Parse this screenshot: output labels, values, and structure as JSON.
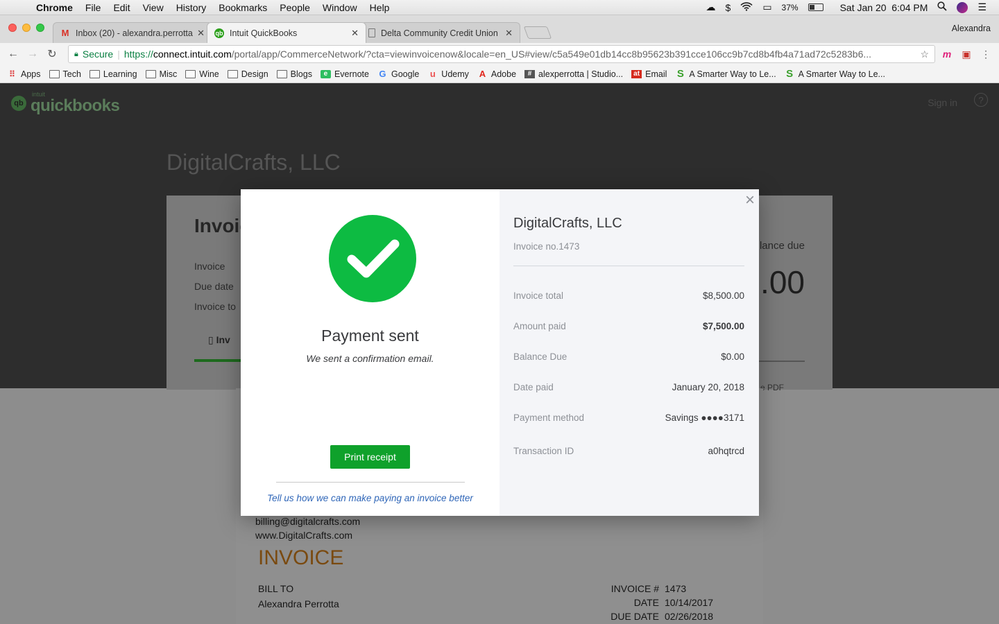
{
  "menubar": {
    "app": "Chrome",
    "items": [
      "File",
      "Edit",
      "View",
      "History",
      "Bookmarks",
      "People",
      "Window",
      "Help"
    ],
    "battery": "37%",
    "datetime": "Sat Jan 20  6:04 PM"
  },
  "tabs": [
    {
      "title": "Inbox (20) - alexandra.perrotta",
      "favicon": "M",
      "color": "#d93025"
    },
    {
      "title": "Intuit QuickBooks",
      "favicon": "qb",
      "color": "#2ca01c"
    },
    {
      "title": "Delta Community Credit Union",
      "favicon": "doc",
      "color": "#555555"
    }
  ],
  "profile": "Alexandra",
  "address": {
    "secure": "Secure",
    "https": "https://",
    "host": "connect.intuit.com",
    "path": "/portal/app/CommerceNetwork/?cta=viewinvoicenow&locale=en_US#view/c5a549e01db14cc8b95623b391cce106cc9b7cd8b4fb4a71ad72c5283b6..."
  },
  "bookmarks": [
    {
      "label": "Apps",
      "icon": "apps-icon"
    },
    {
      "label": "Tech",
      "icon": "folder-icon"
    },
    {
      "label": "Learning",
      "icon": "folder-icon"
    },
    {
      "label": "Misc",
      "icon": "folder-icon"
    },
    {
      "label": "Wine",
      "icon": "folder-icon"
    },
    {
      "label": "Design",
      "icon": "folder-icon"
    },
    {
      "label": "Blogs",
      "icon": "folder-icon"
    },
    {
      "label": "Evernote",
      "icon": "evernote-icon"
    },
    {
      "label": "Google",
      "icon": "google-icon"
    },
    {
      "label": "Udemy",
      "icon": "udemy-icon"
    },
    {
      "label": "Adobe",
      "icon": "adobe-icon"
    },
    {
      "label": "alexperrotta | Studio...",
      "icon": "hash-icon"
    },
    {
      "label": "Email",
      "icon": "at-icon"
    },
    {
      "label": "A Smarter Way to Le...",
      "icon": "s-icon"
    },
    {
      "label": "A Smarter Way to Le...",
      "icon": "s-icon"
    }
  ],
  "qb": {
    "logo_small": "intuit",
    "logo": "quickbooks",
    "signin": "Sign in",
    "help": "?",
    "company": "DigitalCrafts, LLC",
    "card_heading": "Invoic",
    "rows": [
      "Invoice",
      "Due date",
      "Invoice to"
    ],
    "balance_label": "lance due",
    "balance_amount": ".00",
    "tab_label": "Inv",
    "pdf_label": "e PDF"
  },
  "invoice_doc": {
    "email": "billing@digitalcrafts.com",
    "website": "www.DigitalCrafts.com",
    "title": "INVOICE",
    "bill_to_label": "BILL TO",
    "bill_to_name": "Alexandra Perrotta",
    "invoice_no_label": "INVOICE #",
    "invoice_no": "1473",
    "date_label": "DATE",
    "date": "10/14/2017",
    "due_label": "DUE DATE",
    "due": "02/26/2018"
  },
  "modal": {
    "title": "Payment sent",
    "subtitle": "We sent a confirmation email.",
    "print_button": "Print receipt",
    "feedback": "Tell us how we can make paying an invoice better",
    "close": "×",
    "company": "DigitalCrafts, LLC",
    "invoice_no": "Invoice no.1473",
    "details": [
      {
        "label": "Invoice total",
        "value": "$8,500.00",
        "bold": false
      },
      {
        "label": "Amount paid",
        "value": "$7,500.00",
        "bold": true
      },
      {
        "label": "Balance Due",
        "value": "$0.00",
        "bold": false
      },
      {
        "label": "Date paid",
        "value": "January 20, 2018",
        "bold": false
      },
      {
        "label": "Payment method",
        "value": "Savings ●●●●3171",
        "bold": false
      },
      {
        "label": "Transaction ID",
        "value": "a0hqtrcd",
        "bold": false
      }
    ],
    "accent": "#0dbb42",
    "button_color": "#0fa12b"
  }
}
